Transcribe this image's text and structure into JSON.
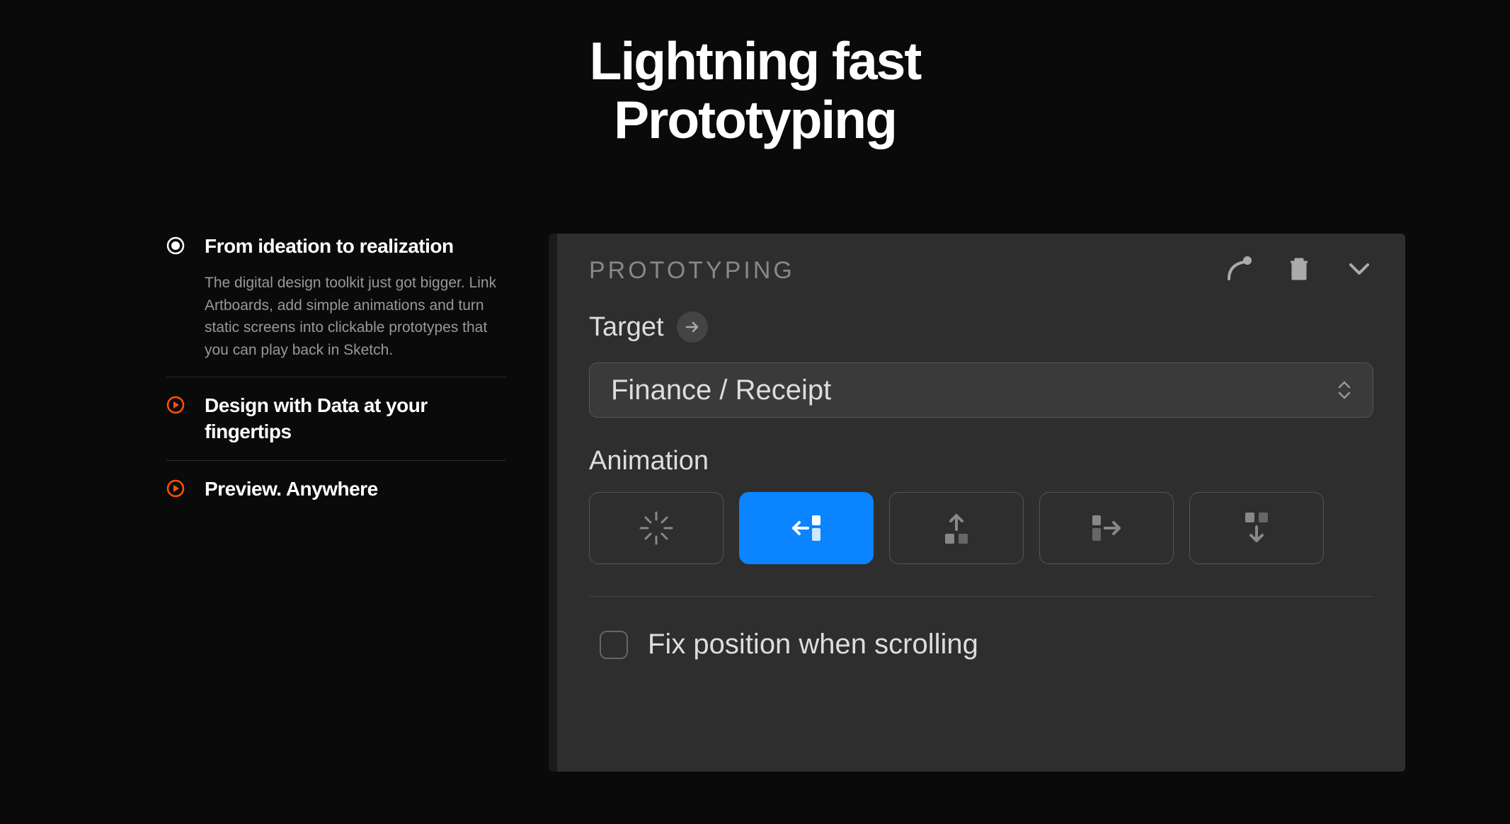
{
  "hero": {
    "title": "Lightning fast\nPrototyping"
  },
  "features": [
    {
      "title": "From ideation to realization",
      "description": "The digital design toolkit just got bigger. Link Artboards, add simple animations and turn static screens into clickable prototypes that you can play back in Sketch.",
      "active": true
    },
    {
      "title": "Design with Data at your fingertips",
      "active": false
    },
    {
      "title": "Preview. Anywhere",
      "active": false
    }
  ],
  "panel": {
    "title": "PROTOTYPING",
    "target_label": "Target",
    "target_value": "Finance / Receipt",
    "animation_label": "Animation",
    "animation_options": [
      "none",
      "slide-left",
      "slide-up",
      "slide-right",
      "slide-down"
    ],
    "animation_selected": 1,
    "checkbox_label": "Fix position when scrolling",
    "checkbox_checked": false
  },
  "colors": {
    "accent_orange": "#ff5500",
    "accent_blue": "#0a84ff"
  }
}
